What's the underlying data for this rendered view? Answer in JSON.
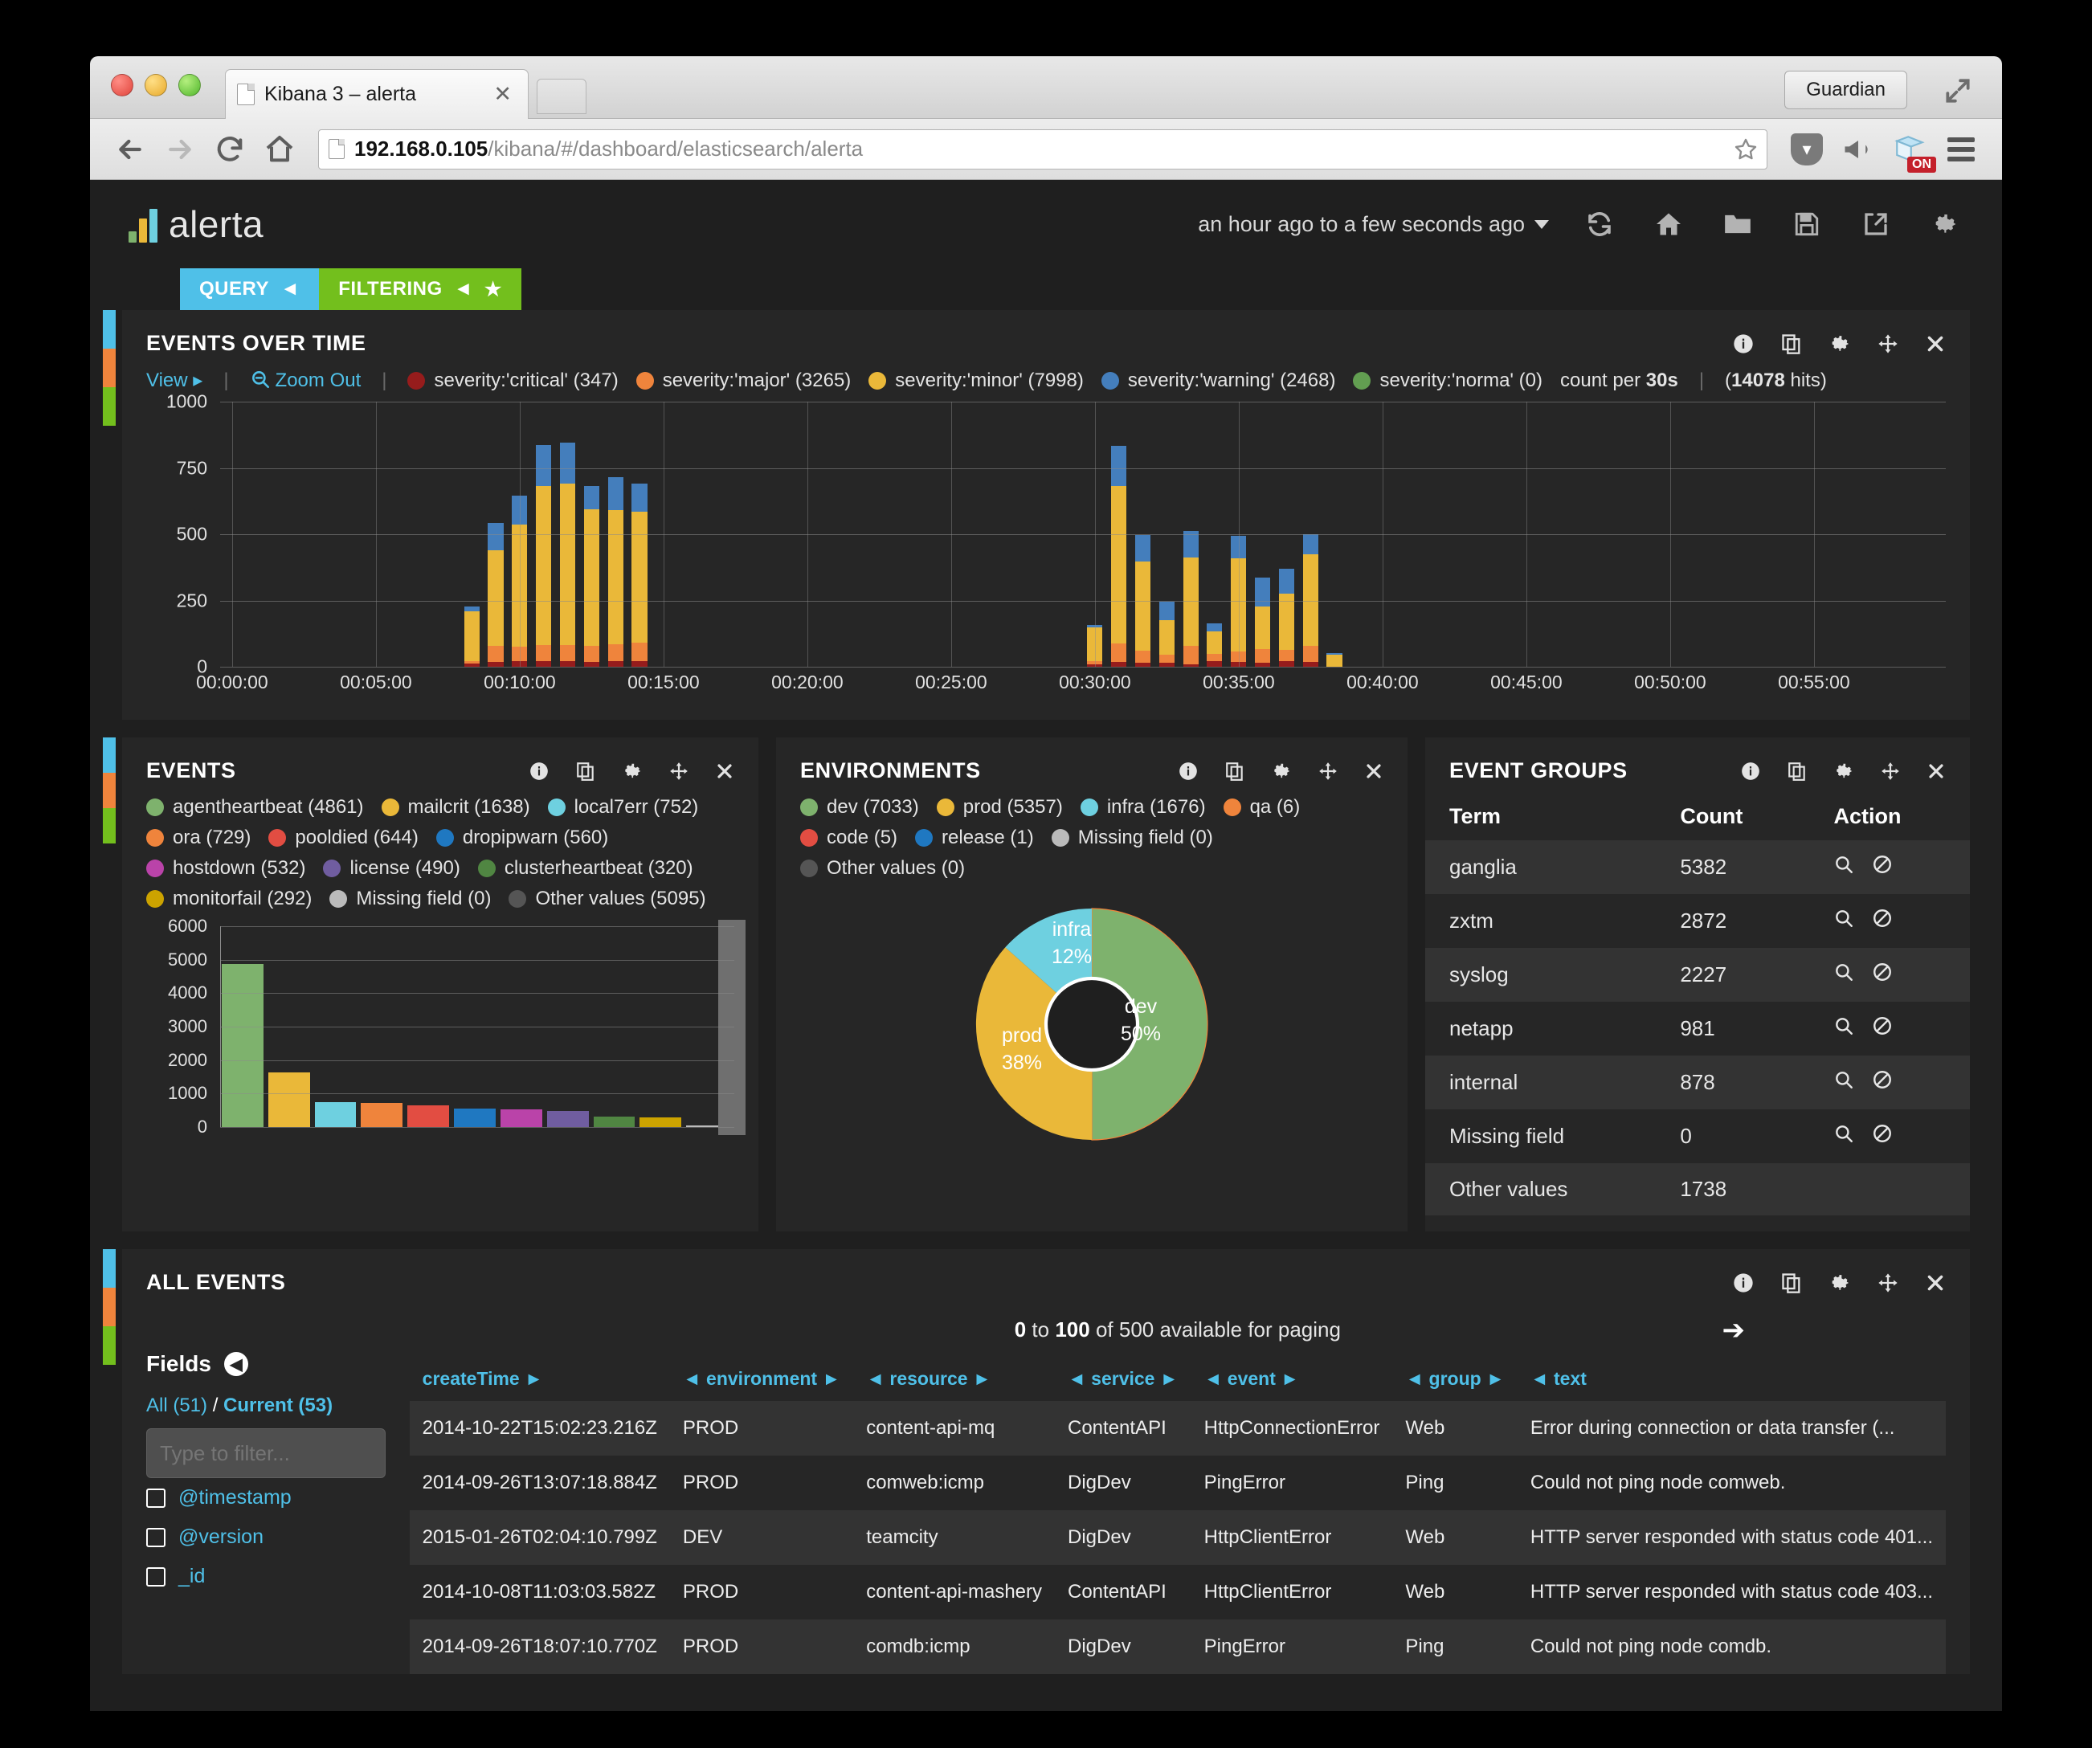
{
  "browser": {
    "tab_title": "Kibana 3 – alerta",
    "tab_close": "✕",
    "url_host": "192.168.0.105",
    "url_path": "/kibana/#/dashboard/elasticsearch/alerta",
    "guardian_label": "Guardian",
    "extension_on_badge": "ON"
  },
  "header": {
    "app_name": "alerta",
    "time_range": "an hour ago to a few seconds ago",
    "query_tab": "QUERY",
    "filtering_tab": "FILTERING"
  },
  "events_over_time": {
    "title": "EVENTS OVER TIME",
    "view_label": "View",
    "zoom_out_label": "Zoom Out",
    "count_per_prefix": "count per",
    "count_per_value": "30s",
    "hits_value": "14078",
    "hits_suffix": "hits)",
    "legend": [
      {
        "label": "severity:'critical' (347)",
        "color": "#961c1c"
      },
      {
        "label": "severity:'major' (3265)",
        "color": "#ef843c"
      },
      {
        "label": "severity:'minor' (7998)",
        "color": "#eab839"
      },
      {
        "label": "severity:'warning' (2468)",
        "color": "#447ebc"
      },
      {
        "label": "severity:'norma' (0)",
        "color": "#629e51"
      }
    ]
  },
  "chart_data": [
    {
      "type": "bar",
      "title": "EVENTS OVER TIME",
      "xlabel": "",
      "ylabel": "count per 30s",
      "ylim": [
        0,
        1000
      ],
      "yticks": [
        0,
        250,
        500,
        750,
        1000
      ],
      "xticks": [
        "00:00:00",
        "00:05:00",
        "00:10:00",
        "00:15:00",
        "00:20:00",
        "00:25:00",
        "00:30:00",
        "00:35:00",
        "00:40:00",
        "00:45:00",
        "00:50:00",
        "00:55:00"
      ],
      "stacked": true,
      "grid": true,
      "legend_position": "top",
      "series": [
        {
          "name": "severity:'critical'",
          "color": "#961c1c",
          "values": [
            0,
            0,
            0,
            0,
            0,
            0,
            0,
            0,
            0,
            0,
            12,
            18,
            20,
            22,
            20,
            18,
            20,
            22,
            0,
            0,
            0,
            0,
            0,
            0,
            0,
            0,
            0,
            0,
            0,
            0,
            0,
            0,
            0,
            0,
            0,
            0,
            8,
            18,
            14,
            16,
            10,
            20,
            18,
            16,
            20,
            18,
            0,
            0,
            0,
            0,
            0,
            0,
            0,
            0,
            0,
            0,
            0,
            0,
            0,
            0,
            0,
            0,
            0,
            0,
            0,
            0,
            0,
            0,
            0,
            0,
            0,
            0
          ]
        },
        {
          "name": "severity:'major'",
          "color": "#ef843c",
          "values": [
            0,
            0,
            0,
            0,
            0,
            0,
            0,
            0,
            0,
            0,
            8,
            60,
            55,
            60,
            62,
            60,
            65,
            68,
            0,
            0,
            0,
            0,
            0,
            0,
            0,
            0,
            0,
            0,
            0,
            0,
            0,
            0,
            0,
            0,
            0,
            0,
            12,
            70,
            48,
            30,
            68,
            28,
            40,
            50,
            45,
            62,
            0,
            0,
            0,
            0,
            0,
            0,
            0,
            0,
            0,
            0,
            0,
            0,
            0,
            0,
            0,
            0,
            0,
            0,
            0,
            0,
            0,
            0,
            0,
            0,
            0,
            0
          ]
        },
        {
          "name": "severity:'minor'",
          "color": "#eab839",
          "values": [
            0,
            0,
            0,
            0,
            0,
            0,
            0,
            0,
            0,
            0,
            190,
            360,
            460,
            600,
            610,
            515,
            505,
            495,
            0,
            0,
            0,
            0,
            0,
            0,
            0,
            0,
            0,
            0,
            0,
            0,
            0,
            0,
            0,
            0,
            0,
            0,
            130,
            595,
            335,
            130,
            335,
            85,
            350,
            160,
            210,
            345,
            45,
            0,
            0,
            0,
            0,
            0,
            0,
            0,
            0,
            0,
            0,
            0,
            0,
            0,
            0,
            0,
            0,
            0,
            0,
            0,
            0,
            0,
            0,
            0,
            0,
            0
          ]
        },
        {
          "name": "severity:'warning'",
          "color": "#447ebc",
          "values": [
            0,
            0,
            0,
            0,
            0,
            0,
            0,
            0,
            0,
            0,
            18,
            105,
            110,
            155,
            155,
            90,
            125,
            105,
            0,
            0,
            0,
            0,
            0,
            0,
            0,
            0,
            0,
            0,
            0,
            0,
            0,
            0,
            0,
            0,
            0,
            0,
            8,
            150,
            100,
            70,
            100,
            30,
            85,
            110,
            95,
            75,
            8,
            0,
            0,
            0,
            0,
            0,
            0,
            0,
            0,
            0,
            0,
            0,
            0,
            0,
            0,
            0,
            0,
            0,
            0,
            0,
            0,
            0,
            0,
            0,
            0,
            0
          ]
        }
      ]
    },
    {
      "type": "bar",
      "title": "EVENTS",
      "ylim": [
        0,
        6000
      ],
      "yticks": [
        0,
        1000,
        2000,
        3000,
        4000,
        5000,
        6000
      ],
      "categories": [
        "agentheartbeat",
        "mailcrit",
        "local7err",
        "ora",
        "pooldied",
        "dropipwarn",
        "hostdown",
        "license",
        "clusterheartbeat",
        "monitorfail",
        "Missing field"
      ],
      "values": [
        4861,
        1638,
        752,
        729,
        644,
        560,
        532,
        490,
        320,
        292,
        0
      ],
      "colors": [
        "#7eb26d",
        "#eab839",
        "#6ed0e0",
        "#ef843c",
        "#e24d42",
        "#1f78c1",
        "#ba43a9",
        "#705da0",
        "#508642",
        "#cca300",
        "#bbbbbb"
      ]
    },
    {
      "type": "pie",
      "title": "ENVIRONMENTS",
      "labels": [
        "dev",
        "prod",
        "infra"
      ],
      "values": [
        50,
        38,
        12
      ],
      "value_unit": "%",
      "colors": [
        "#7eb26d",
        "#eab839",
        "#6ed0e0"
      ],
      "donut": true
    }
  ],
  "events_panel": {
    "title": "EVENTS",
    "legend": [
      {
        "label": "agentheartbeat (4861)",
        "color": "#7eb26d"
      },
      {
        "label": "mailcrit (1638)",
        "color": "#eab839"
      },
      {
        "label": "local7err (752)",
        "color": "#6ed0e0"
      },
      {
        "label": "ora (729)",
        "color": "#ef843c"
      },
      {
        "label": "pooldied (644)",
        "color": "#e24d42"
      },
      {
        "label": "dropipwarn (560)",
        "color": "#1f78c1"
      },
      {
        "label": "hostdown (532)",
        "color": "#ba43a9"
      },
      {
        "label": "license (490)",
        "color": "#705da0"
      },
      {
        "label": "clusterheartbeat (320)",
        "color": "#508642"
      },
      {
        "label": "monitorfail (292)",
        "color": "#cca300"
      },
      {
        "label": "Missing field (0)",
        "color": "#bbbbbb"
      },
      {
        "label": "Other values (5095)",
        "color": "#555555"
      }
    ],
    "yticks": [
      "6000",
      "5000",
      "4000",
      "3000",
      "2000",
      "1000",
      "0"
    ]
  },
  "environments_panel": {
    "title": "ENVIRONMENTS",
    "legend": [
      {
        "label": "dev (7033)",
        "color": "#7eb26d"
      },
      {
        "label": "prod (5357)",
        "color": "#eab839"
      },
      {
        "label": "infra (1676)",
        "color": "#6ed0e0"
      },
      {
        "label": "qa (6)",
        "color": "#ef843c"
      },
      {
        "label": "code (5)",
        "color": "#e24d42"
      },
      {
        "label": "release (1)",
        "color": "#1f78c1"
      },
      {
        "label": "Missing field (0)",
        "color": "#bbbbbb"
      },
      {
        "label": "Other values (0)",
        "color": "#555555"
      }
    ],
    "slices": [
      {
        "label": "dev",
        "pct": "50%"
      },
      {
        "label": "prod",
        "pct": "38%"
      },
      {
        "label": "infra",
        "pct": "12%"
      }
    ]
  },
  "event_groups": {
    "title": "EVENT GROUPS",
    "columns": [
      "Term",
      "Count",
      "Action"
    ],
    "rows": [
      {
        "term": "ganglia",
        "count": "5382",
        "has_action": true
      },
      {
        "term": "zxtm",
        "count": "2872",
        "has_action": true
      },
      {
        "term": "syslog",
        "count": "2227",
        "has_action": true
      },
      {
        "term": "netapp",
        "count": "981",
        "has_action": true
      },
      {
        "term": "internal",
        "count": "878",
        "has_action": true
      },
      {
        "term": "Missing field",
        "count": "0",
        "has_action": true
      },
      {
        "term": "Other values",
        "count": "1738",
        "has_action": false
      }
    ]
  },
  "all_events": {
    "title": "ALL EVENTS",
    "paging_from": "0",
    "paging_to": "100",
    "paging_text_mid": "to",
    "paging_text_end": "of 500 available for paging",
    "fields_title": "Fields",
    "all_label": "All (51)",
    "current_label": "Current (53)",
    "filter_placeholder": "Type to filter...",
    "field_items": [
      "@timestamp",
      "@version",
      "_id"
    ],
    "columns": [
      "createTime",
      "environment",
      "resource",
      "service",
      "event",
      "group",
      "text"
    ],
    "rows": [
      {
        "createTime": "2014-10-22T15:02:23.216Z",
        "environment": "PROD",
        "resource": "content-api-mq",
        "service": "ContentAPI",
        "event": "HttpConnectionError",
        "group": "Web",
        "text": "Error during connection or data transfer (..."
      },
      {
        "createTime": "2014-09-26T13:07:18.884Z",
        "environment": "PROD",
        "resource": "comweb:icmp",
        "service": "DigDev",
        "event": "PingError",
        "group": "Ping",
        "text": "Could not ping node comweb."
      },
      {
        "createTime": "2015-01-26T02:04:10.799Z",
        "environment": "DEV",
        "resource": "teamcity",
        "service": "DigDev",
        "event": "HttpClientError",
        "group": "Web",
        "text": "HTTP server responded with status code 401..."
      },
      {
        "createTime": "2014-10-08T11:03:03.582Z",
        "environment": "PROD",
        "resource": "content-api-mashery",
        "service": "ContentAPI",
        "event": "HttpClientError",
        "group": "Web",
        "text": "HTTP server responded with status code 403..."
      },
      {
        "createTime": "2014-09-26T18:07:10.770Z",
        "environment": "PROD",
        "resource": "comdb:icmp",
        "service": "DigDev",
        "event": "PingError",
        "group": "Ping",
        "text": "Could not ping node comdb."
      }
    ]
  },
  "icons": {
    "info": "info-icon",
    "duplicate": "duplicate-icon",
    "gear": "gear-icon",
    "move": "move-icon",
    "close": "close-icon"
  },
  "colors": {
    "accent_blue": "#4fc0e8",
    "accent_green": "#73bf1d",
    "panel_bg": "#262626",
    "app_bg": "#1f1f1f"
  }
}
